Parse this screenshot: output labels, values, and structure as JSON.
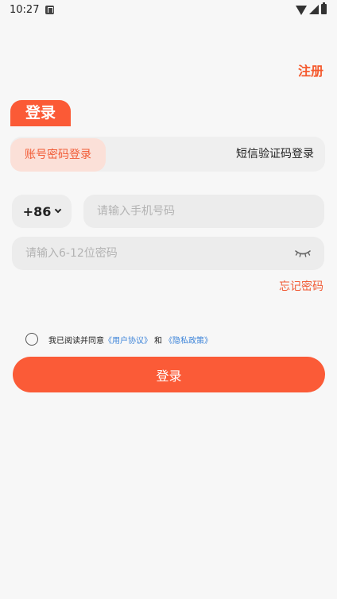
{
  "status_bar": {
    "time": "10:27"
  },
  "header": {
    "register_label": "注册"
  },
  "login_title": "登录",
  "mode_tabs": {
    "account_label": "账号密码登录",
    "sms_label": "短信验证码登录"
  },
  "phone": {
    "country_code": "+86",
    "placeholder": "请输入手机号码"
  },
  "password": {
    "placeholder": "请输入6-12位密码"
  },
  "forgot_label": "忘记密码",
  "agreement": {
    "prefix": "我已阅读并同意",
    "user_agreement": "《用户协议》",
    "and": "和",
    "privacy_policy": "《隐私政策》"
  },
  "login_button_label": "登录",
  "colors": {
    "accent": "#fb5a36",
    "link": "#3d84d9",
    "background": "#f7f7f7"
  },
  "icons": [
    "notification-icon",
    "wifi-icon",
    "signal-icon",
    "battery-icon",
    "chevron-down-icon",
    "eye-closed-icon"
  ]
}
